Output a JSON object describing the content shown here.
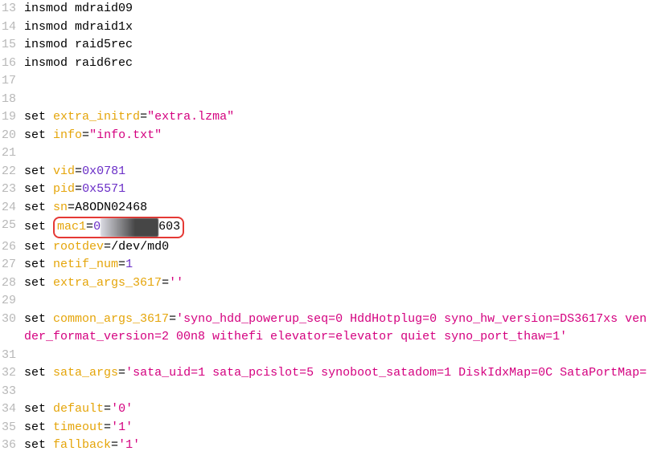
{
  "lines": {
    "l13": {
      "num": "13",
      "cmd": "insmod",
      "arg": "mdraid09"
    },
    "l14": {
      "num": "14",
      "cmd": "insmod",
      "arg": "mdraid1x"
    },
    "l15": {
      "num": "15",
      "cmd": "insmod",
      "arg": "raid5rec"
    },
    "l16": {
      "num": "16",
      "cmd": "insmod",
      "arg": "raid6rec"
    },
    "l17": {
      "num": "17"
    },
    "l18": {
      "num": "18"
    },
    "l19": {
      "num": "19",
      "cmd": "set",
      "var": "extra_initrd",
      "eq": "=",
      "str": "\"extra.lzma\""
    },
    "l20": {
      "num": "20",
      "cmd": "set",
      "var": "info",
      "eq": "=",
      "str": "\"info.txt\""
    },
    "l21": {
      "num": "21"
    },
    "l22": {
      "num": "22",
      "cmd": "set",
      "var": "vid",
      "eq": "=",
      "val": "0x0781"
    },
    "l23": {
      "num": "23",
      "cmd": "set",
      "var": "pid",
      "eq": "=",
      "val": "0x5571"
    },
    "l24": {
      "num": "24",
      "cmd": "set",
      "var": "sn",
      "eq": "=",
      "val": "A8ODN02468"
    },
    "l25": {
      "num": "25",
      "cmd": "set",
      "var": "mac1",
      "eq": "=",
      "val_prefix": "0",
      "val_hidden": "XXXXXXXX",
      "val_suffix": "603"
    },
    "l26": {
      "num": "26",
      "cmd": "set",
      "var": "rootdev",
      "eq": "=",
      "val": "/dev/md0"
    },
    "l27": {
      "num": "27",
      "cmd": "set",
      "var": "netif_num",
      "eq": "=",
      "val": "1"
    },
    "l28": {
      "num": "28",
      "cmd": "set",
      "var": "extra_args_3617",
      "eq": "=",
      "str": "''"
    },
    "l29": {
      "num": "29"
    },
    "l30": {
      "num": "30",
      "cmd": "set",
      "var": "common_args_3617",
      "eq": "=",
      "str": "'syno_hdd_powerup_seq=0 HddHotplug=0 syno_hw_version=DS3617xs vender_format_version=2 00n8 withefi elevator=elevator quiet syno_port_thaw=1'"
    },
    "l31": {
      "num": "31"
    },
    "l32": {
      "num": "32",
      "cmd": "set",
      "var": "sata_args",
      "eq": "=",
      "str": "'sata_uid=1 sata_pcislot=5 synoboot_satadom=1 DiskIdxMap=0C SataPortMap="
    },
    "l33": {
      "num": "33"
    },
    "l34": {
      "num": "34",
      "cmd": "set",
      "var": "default",
      "eq": "=",
      "str": "'0'"
    },
    "l35": {
      "num": "35",
      "cmd": "set",
      "var": "timeout",
      "eq": "=",
      "str": "'1'"
    },
    "l36": {
      "num": "36",
      "cmd": "set",
      "var": "fallback",
      "eq": "=",
      "str": "'1'"
    }
  }
}
